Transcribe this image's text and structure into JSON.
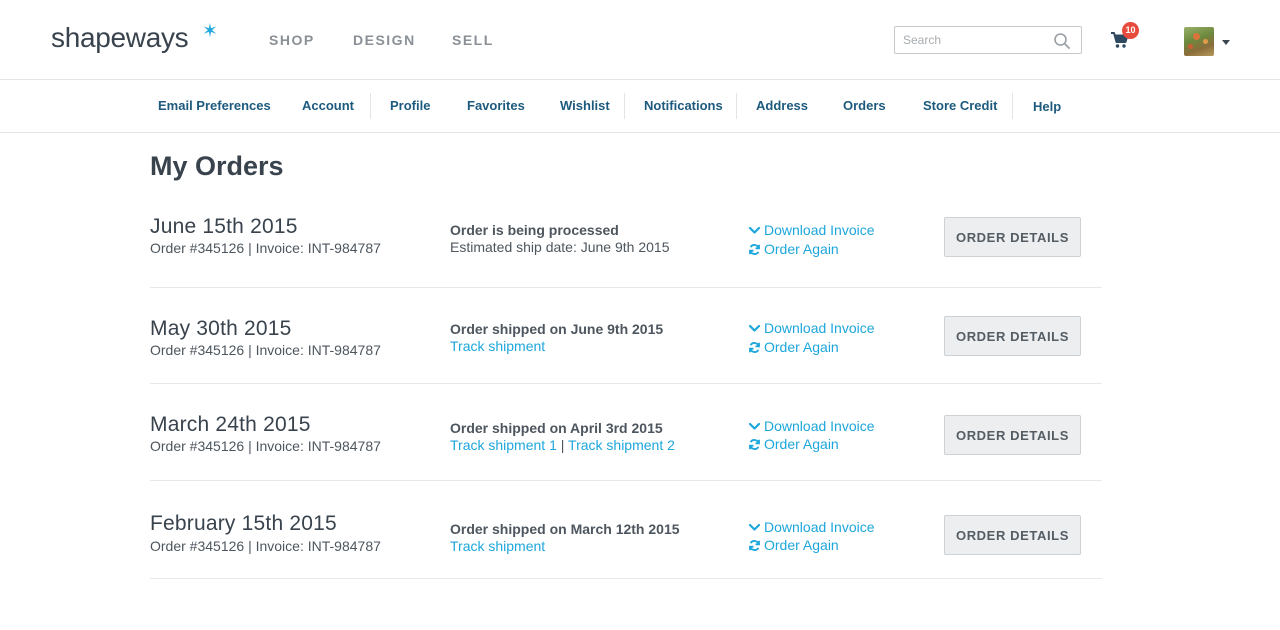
{
  "header": {
    "logo": "shapeways",
    "nav": [
      "SHOP",
      "DESIGN",
      "SELL"
    ],
    "search_placeholder": "Search",
    "cart_count": "10"
  },
  "subnav": {
    "items": [
      "Email Preferences",
      "Account",
      "Profile",
      "Favorites",
      "Wishlist",
      "Notifications",
      "Address",
      "Orders",
      "Store Credit",
      "Help"
    ]
  },
  "page_title": "My Orders",
  "orders": [
    {
      "date": "June 15th 2015",
      "meta": "Order #345126 | Invoice: INT-984787",
      "status": "Order is being processed",
      "substatus": "Estimated ship date: June 9th 2015",
      "download": "Download Invoice",
      "again": "Order Again",
      "button": "ORDER DETAILS"
    },
    {
      "date": "May 30th 2015",
      "meta": "Order #345126 | Invoice: INT-984787",
      "status": "Order shipped on June 9th 2015",
      "track": "Track shipment",
      "download": "Download Invoice",
      "again": "Order Again",
      "button": "ORDER DETAILS"
    },
    {
      "date": "March 24th 2015",
      "meta": "Order #345126 | Invoice: INT-984787",
      "status": "Order shipped on April 3rd 2015",
      "track1": "Track shipment 1",
      "track_sep": " | ",
      "track2": "Track shipment 2",
      "download": "Download Invoice",
      "again": "Order Again",
      "button": "ORDER DETAILS"
    },
    {
      "date": "February 15th 2015",
      "meta": "Order #345126 | Invoice: INT-984787",
      "status": "Order shipped on March 12th 2015",
      "track": "Track shipment",
      "download": "Download Invoice",
      "again": "Order Again",
      "button": "ORDER DETAILS"
    }
  ],
  "colors": {
    "accent": "#1da6dc",
    "subnav_link": "#1d5a7e",
    "badge": "#e64b3c",
    "title": "#39434d"
  }
}
